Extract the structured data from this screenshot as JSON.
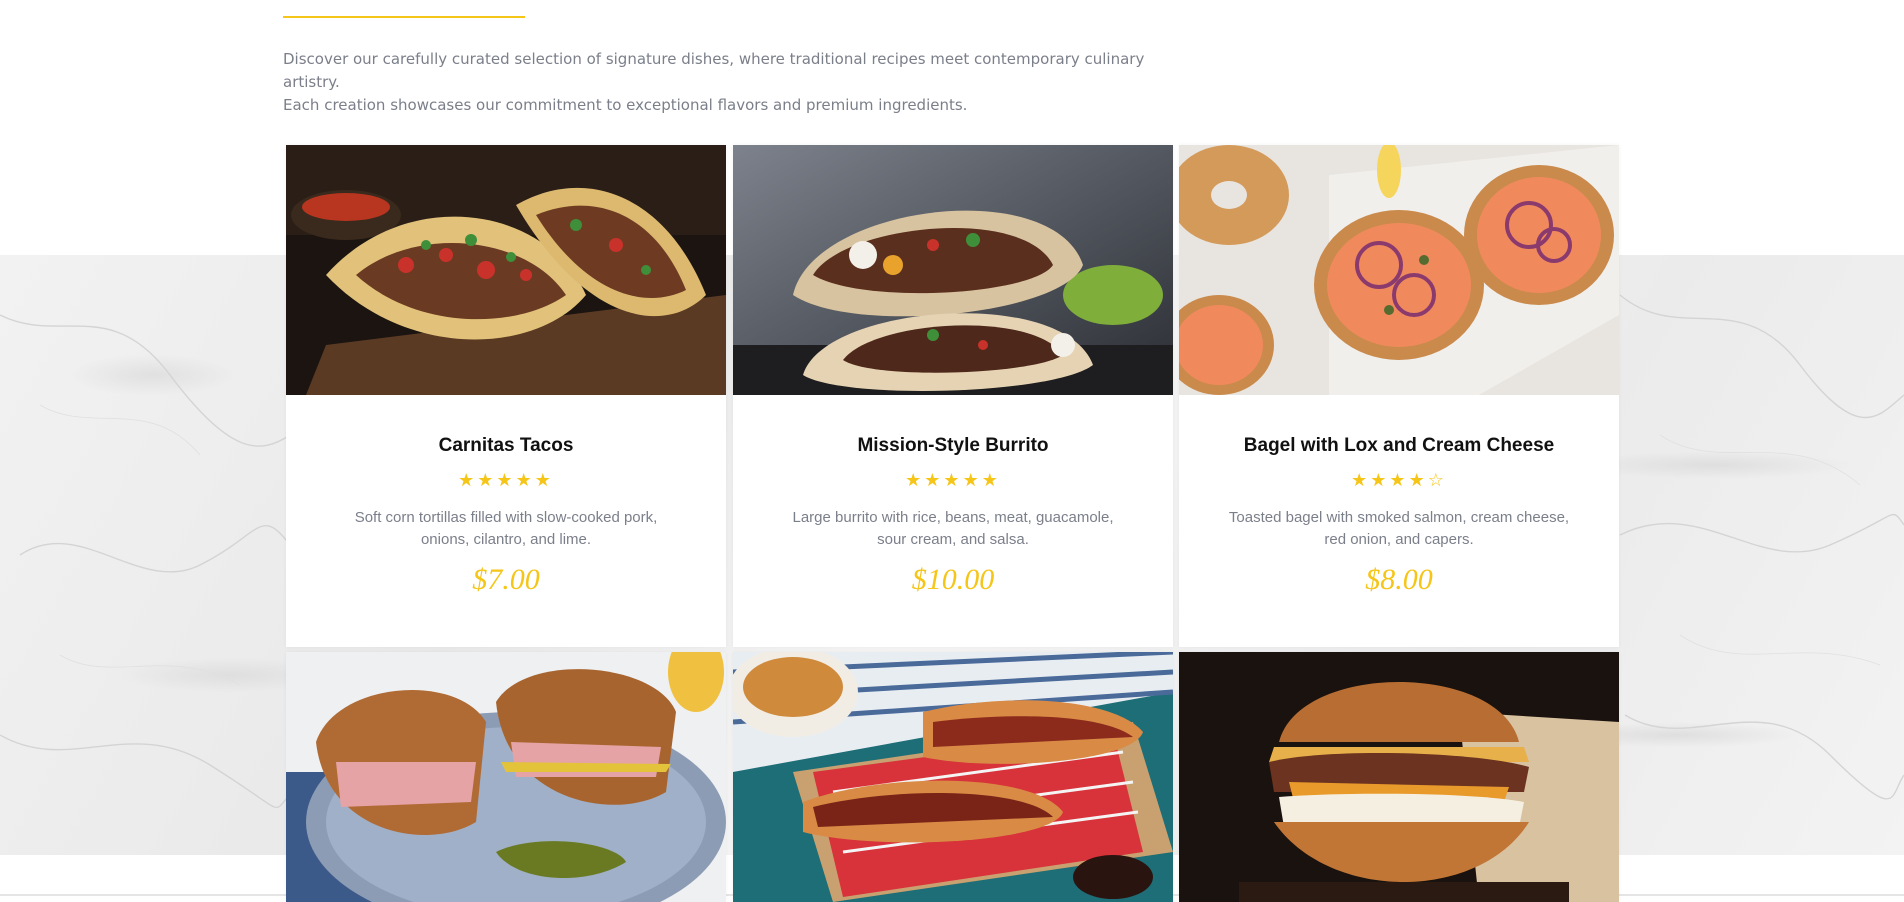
{
  "intro": {
    "line1": "Discover our carefully curated selection of signature dishes, where traditional recipes meet contemporary culinary artistry.",
    "line2": "Each creation showcases our commitment to exceptional flavors and premium ingredients."
  },
  "colors": {
    "accent": "#f5c518",
    "muted_text": "#7b7f8a",
    "title_text": "#111111"
  },
  "menu": {
    "items": [
      {
        "name": "Carnitas Tacos",
        "rating": 5,
        "stars": "★★★★★",
        "description": "Soft corn tortillas filled with slow-cooked pork, onions, cilantro, and lime.",
        "price": "$7.00",
        "image": "tacos-photo"
      },
      {
        "name": "Mission-Style Burrito",
        "rating": 5,
        "stars": "★★★★★",
        "description": "Large burrito with rice, beans, meat, guacamole, sour cream, and salsa.",
        "price": "$10.00",
        "image": "burrito-photo"
      },
      {
        "name": "Bagel with Lox and Cream Cheese",
        "rating": 4,
        "stars": "★★★★☆",
        "description": "Toasted bagel with smoked salmon, cream cheese, red onion, and capers.",
        "price": "$8.00",
        "image": "bagel-lox-photo"
      },
      {
        "image": "cuban-sandwich-photo"
      },
      {
        "image": "hot-dogs-photo"
      },
      {
        "image": "breakfast-sandwich-photo"
      }
    ]
  }
}
